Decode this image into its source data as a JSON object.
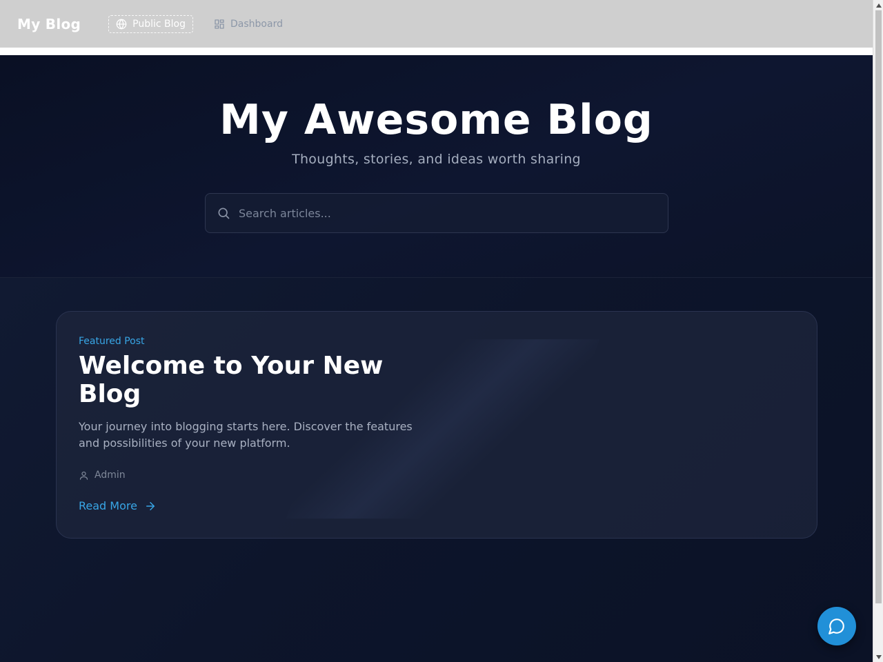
{
  "nav": {
    "brand": "My Blog",
    "links": [
      {
        "label": "Public Blog",
        "icon": "globe-icon"
      },
      {
        "label": "Dashboard",
        "icon": "dashboard-icon"
      }
    ]
  },
  "hero": {
    "title": "My Awesome Blog",
    "subtitle": "Thoughts, stories, and ideas worth sharing",
    "search_placeholder": "Search articles..."
  },
  "featured_post": {
    "badge": "Featured Post",
    "title": "Welcome to Your New Blog",
    "excerpt": "Your journey into blogging starts here. Discover the features and possibilities of your new platform.",
    "author": "Admin",
    "read_more": "Read More"
  },
  "colors": {
    "accent": "#38a6e6",
    "chat_button": "#2190d8",
    "navbar_bg": "#cfcfcf",
    "page_bg": "#0b1122"
  },
  "icons": {
    "search": "search-icon",
    "author": "user-icon",
    "read_more": "arrow-right-icon",
    "chat": "chat-bubble-icon"
  }
}
